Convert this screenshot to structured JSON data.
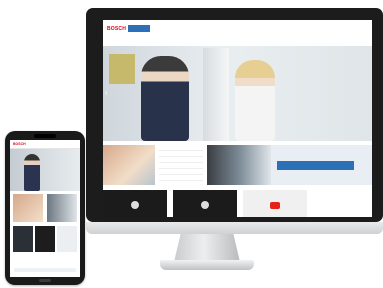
{
  "desktop": {
    "brand": "BOSCH",
    "sub_brand": "",
    "header_links": "",
    "nav_items": [],
    "hero": {
      "badge": "",
      "caption": "",
      "arrow_glyph": "‹"
    },
    "table_rows": [],
    "banner_text": "",
    "videos": [
      {
        "title": "",
        "style": "play"
      },
      {
        "title": "",
        "style": "play"
      },
      {
        "title": "",
        "style": "youtube"
      }
    ]
  },
  "phone": {
    "brand": "BOSCH",
    "hero_caption": "",
    "footer_text": ""
  },
  "colors": {
    "brand_red": "#e20015",
    "brand_blue": "#2c70b8",
    "monitor_frame": "#1c1c1c",
    "phone_frame": "#1a1a1a"
  }
}
